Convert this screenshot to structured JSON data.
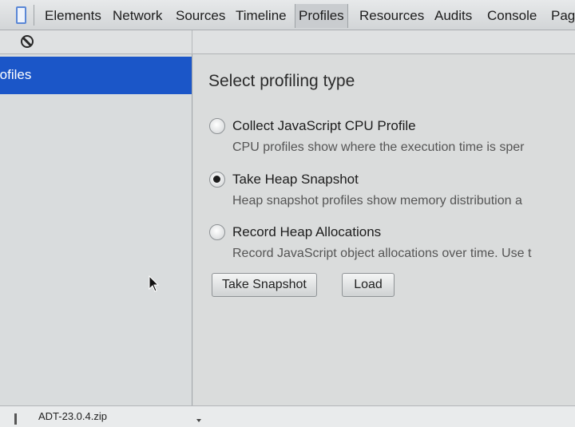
{
  "tabs": [
    {
      "label": "Elements"
    },
    {
      "label": "Network"
    },
    {
      "label": "Sources"
    },
    {
      "label": "Timeline"
    },
    {
      "label": "Profiles",
      "active": true
    },
    {
      "label": "Resources"
    },
    {
      "label": "Audits"
    },
    {
      "label": "Console"
    },
    {
      "label": "Pag"
    }
  ],
  "sidebar": {
    "items": [
      {
        "label": "rofiles",
        "selected": true
      }
    ]
  },
  "main": {
    "title": "Select profiling type",
    "options": [
      {
        "label": "Collect JavaScript CPU Profile",
        "description": "CPU profiles show where the execution time is sper",
        "checked": false
      },
      {
        "label": "Take Heap Snapshot",
        "description": "Heap snapshot profiles show memory distribution a",
        "checked": true
      },
      {
        "label": "Record Heap Allocations",
        "description": "Record JavaScript object allocations over time. Use t",
        "checked": false
      }
    ],
    "buttons": {
      "take_snapshot": "Take Snapshot",
      "load": "Load"
    }
  },
  "downloads": {
    "file": "ADT-23.0.4.zip"
  },
  "icons": {
    "dock": "dock-icon",
    "clear": "clear-icon",
    "cursor": "mouse-pointer-icon"
  },
  "colors": {
    "selection": "#1b56c8",
    "dock_icon": "#5a87d6"
  }
}
